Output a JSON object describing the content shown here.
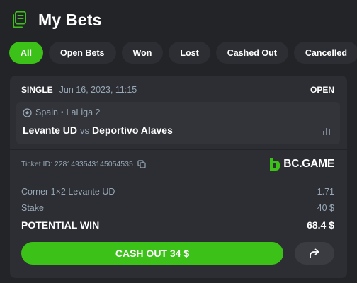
{
  "header": {
    "title": "My Bets",
    "icon": "bets-list-icon"
  },
  "filters": [
    {
      "label": "All",
      "active": true
    },
    {
      "label": "Open Bets"
    },
    {
      "label": "Won"
    },
    {
      "label": "Lost"
    },
    {
      "label": "Cashed Out"
    },
    {
      "label": "Cancelled"
    }
  ],
  "bet": {
    "type": "SINGLE",
    "date": "Jun 16, 2023, 11:15",
    "status": "OPEN",
    "match": {
      "country": "Spain",
      "league": "LaLiga 2",
      "home": "Levante UD",
      "vs": "vs",
      "away": "Deportivo Alaves"
    },
    "ticket": "Ticket ID: 2281493543145054535",
    "brand": "BC.GAME",
    "selection_label": "Corner 1×2 Levante UD",
    "selection_odds": "1.71",
    "stake_label": "Stake",
    "stake_value": "40 $",
    "win_label": "POTENTIAL WIN",
    "win_value": "68.4 $",
    "cashout_label": "CASH OUT 34 $"
  },
  "colors": {
    "accent": "#3bc117",
    "background": "#232428",
    "card": "#2c2e33",
    "muted_text": "#98a7b5"
  }
}
